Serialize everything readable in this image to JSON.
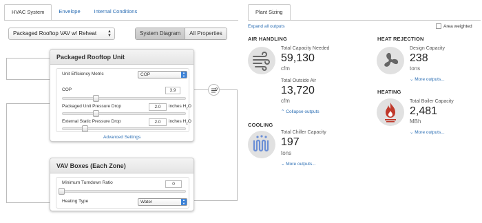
{
  "left_tabs": [
    "HVAC System",
    "Envelope",
    "Internal Conditions"
  ],
  "system_select": {
    "value": "Packaged Rooftop VAV w/ Reheat"
  },
  "view_toggle": [
    "System Diagram",
    "All Properties"
  ],
  "rooftop_card": {
    "title": "Packaged Rooftop Unit",
    "efficiency_metric": {
      "label": "Unit Efficiency Metric",
      "value": "COP"
    },
    "cop": {
      "label": "COP",
      "value": "3.9",
      "slider_fraction": 0.27
    },
    "pressure_drop": {
      "label": "Packaged Unit Pressure Drop",
      "value": "2.0",
      "unit": "inches H",
      "unit_sub": "2",
      "unit_end": "O",
      "slider_fraction": 0.27
    },
    "static_pressure": {
      "label": "External Static Pressure Drop",
      "value": "2.0",
      "unit": "inches H",
      "unit_sub": "2",
      "unit_end": "O",
      "slider_fraction": 0.18
    },
    "advanced_link": "Advanced Settings"
  },
  "vav_card": {
    "title": "VAV Boxes (Each Zone)",
    "min_turndown": {
      "label": "Minimum Turndown Ratio",
      "value": "0",
      "slider_fraction": 0.0
    },
    "heating_type": {
      "label": "Heating Type",
      "value": "Water"
    }
  },
  "right_tab": "Plant Sizing",
  "expand_link": "Expand all outputs",
  "area_weighted": {
    "label": "Area weighted",
    "checked": false
  },
  "air_handling": {
    "title": "AIR HANDLING",
    "icon": "wind-icon",
    "total_capacity": {
      "label": "Total Capacity Needed",
      "value": "59,130",
      "unit": "cfm"
    },
    "outside_air": {
      "label": "Total Outside Air",
      "value": "13,720",
      "unit": "cfm"
    },
    "collapse_link": "Collapse outputs"
  },
  "cooling": {
    "title": "COOLING",
    "icon": "chiller-coil-icon",
    "label": "Total Chiller Capacity",
    "value": "197",
    "unit": "tons",
    "more_link": "More outputs..."
  },
  "heat_rejection": {
    "title": "HEAT REJECTION",
    "icon": "fan-icon",
    "label": "Design Capacity",
    "value": "238",
    "unit": "tons",
    "more_link": "More outputs..."
  },
  "heating": {
    "title": "HEATING",
    "icon": "boiler-flame-icon",
    "label": "Total Boiler Capacity",
    "value": "2,481",
    "unit": "MBh",
    "more_link": "More outputs..."
  },
  "colors": {
    "link": "#2a6db3",
    "icon_circle": "#e1e1e1",
    "cooling_blue": "#6b8fd6",
    "heating_red": "#c0392b"
  }
}
